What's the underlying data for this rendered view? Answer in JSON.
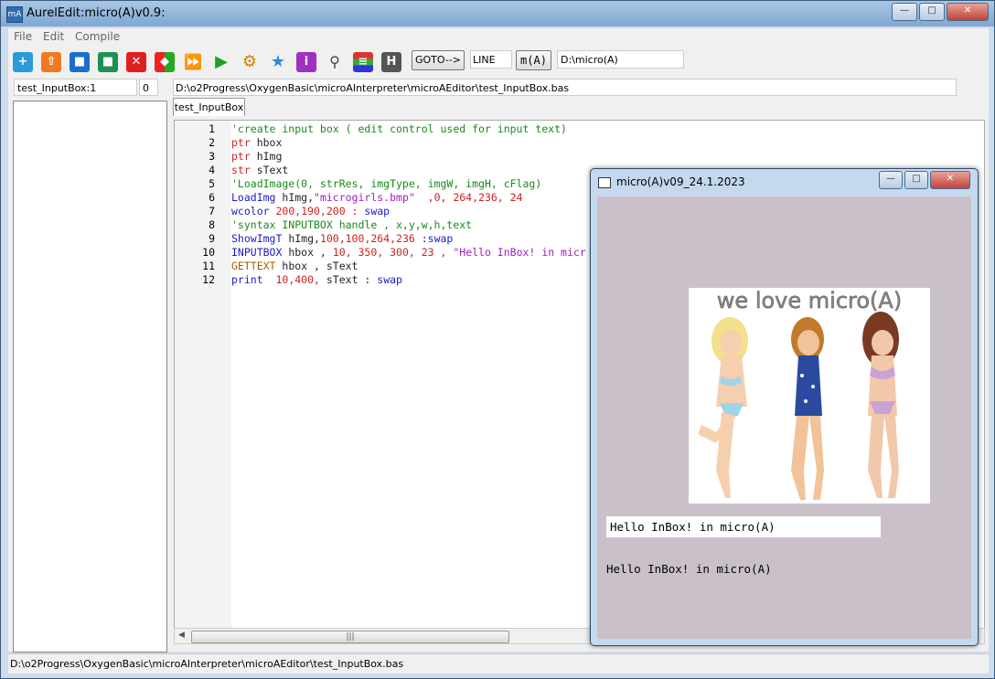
{
  "main": {
    "title": "AurelEdit:micro(A)v0.9:",
    "menu": [
      "File",
      "Edit",
      "Compile"
    ],
    "toolbar": {
      "goto_label": "GOTO-->",
      "line_value": "LINE",
      "ma_label": "m(A)",
      "dir_value": "D:\\micro(A)"
    },
    "name_field": "test_InputBox:1",
    "num_field": "0",
    "path_field": "D:\\o2Progress\\OxygenBasic\\microAInterpreter\\microAEditor\\test_InputBox.bas",
    "tab_label": "test_InputBox",
    "status": "D:\\o2Progress\\OxygenBasic\\microAInterpreter\\microAEditor\\test_InputBox.bas"
  },
  "code_lines": [
    {
      "n": "1",
      "segments": [
        {
          "t": "'create input box ( edit control used for input text)",
          "c": "c-green"
        }
      ]
    },
    {
      "n": "2",
      "segments": [
        {
          "t": "ptr",
          "c": "c-red"
        },
        {
          "t": " hbox",
          "c": "c-dark"
        }
      ]
    },
    {
      "n": "3",
      "segments": [
        {
          "t": "ptr",
          "c": "c-red"
        },
        {
          "t": " hImg",
          "c": "c-dark"
        }
      ]
    },
    {
      "n": "4",
      "segments": [
        {
          "t": "str",
          "c": "c-red"
        },
        {
          "t": " sText",
          "c": "c-dark"
        }
      ]
    },
    {
      "n": "5",
      "segments": [
        {
          "t": "'LoadImage(0, strRes, imgType, imgW, imgH, cFlag)",
          "c": "c-green"
        }
      ]
    },
    {
      "n": "6",
      "segments": [
        {
          "t": "LoadImg",
          "c": "c-blue"
        },
        {
          "t": " hImg,",
          "c": "c-dark"
        },
        {
          "t": "\"microgirls.bmp\"",
          "c": "c-purple"
        },
        {
          "t": "  ,0, 264,236, 24",
          "c": "c-red"
        }
      ]
    },
    {
      "n": "7",
      "segments": [
        {
          "t": "wcolor",
          "c": "c-blue"
        },
        {
          "t": " 200,190,200 : ",
          "c": "c-red"
        },
        {
          "t": "swap",
          "c": "c-blue"
        }
      ]
    },
    {
      "n": "8",
      "segments": [
        {
          "t": "'syntax INPUTBOX handle , x,y,w,h,text",
          "c": "c-green"
        }
      ]
    },
    {
      "n": "9",
      "segments": [
        {
          "t": "ShowImgT",
          "c": "c-blue"
        },
        {
          "t": " hImg,",
          "c": "c-dark"
        },
        {
          "t": "100,100,264,236",
          "c": "c-red"
        },
        {
          "t": " :swap",
          "c": "c-blue"
        }
      ]
    },
    {
      "n": "10",
      "segments": [
        {
          "t": "INPUTBOX",
          "c": "c-blue"
        },
        {
          "t": " hbox , ",
          "c": "c-dark"
        },
        {
          "t": "10, 350, 300, 23 , ",
          "c": "c-red"
        },
        {
          "t": "\"Hello InBox! in micr",
          "c": "c-purple"
        }
      ]
    },
    {
      "n": "11",
      "segments": [
        {
          "t": "GETTEXT",
          "c": "c-brown"
        },
        {
          "t": " hbox , sText",
          "c": "c-dark"
        }
      ]
    },
    {
      "n": "12",
      "segments": [
        {
          "t": "print",
          "c": "c-blue"
        },
        {
          "t": "  10,400, ",
          "c": "c-red"
        },
        {
          "t": "sText : ",
          "c": "c-dark"
        },
        {
          "t": "swap",
          "c": "c-blue"
        }
      ]
    }
  ],
  "child": {
    "title": "micro(A)v09_24.1.2023",
    "picture_caption": "we love micro(A)",
    "inbox_value": "Hello InBox! in micro(A)",
    "printed_text": "Hello InBox! in micro(A)"
  }
}
